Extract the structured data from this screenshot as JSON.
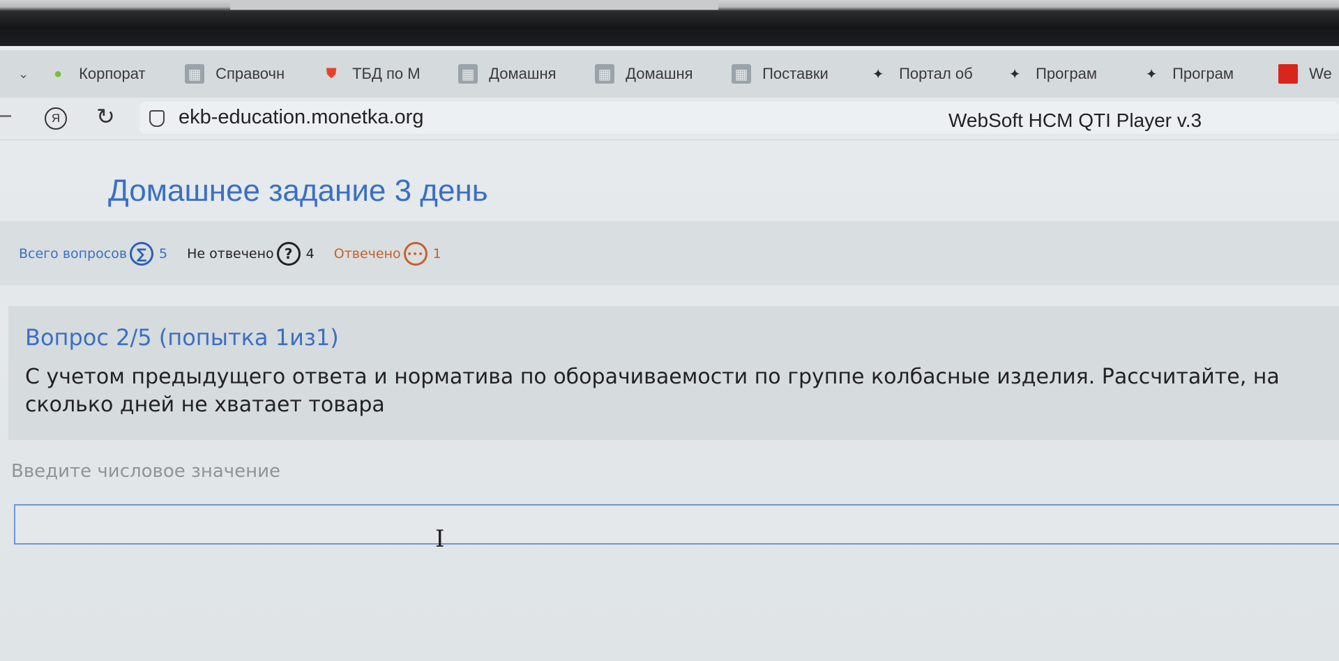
{
  "bookmarks": [
    {
      "label": "Корпорат",
      "icon": "map-pin-icon"
    },
    {
      "label": "Справочн",
      "icon": "chart-icon"
    },
    {
      "label": "ТБД по М",
      "icon": "shield-icon"
    },
    {
      "label": "Домашня",
      "icon": "chart-icon"
    },
    {
      "label": "Домашня",
      "icon": "chart-icon"
    },
    {
      "label": "Поставки",
      "icon": "chart-icon"
    },
    {
      "label": "Портал об",
      "icon": "star-icon"
    },
    {
      "label": "Програм",
      "icon": "star-icon"
    },
    {
      "label": "Програм",
      "icon": "star-icon"
    },
    {
      "label": "We",
      "icon": "red-square-icon"
    }
  ],
  "browser": {
    "yandex_glyph": "Я",
    "reload_glyph": "↻",
    "url": "ekb-education.monetka.org",
    "page_title": "WebSoft HCM QTI Player v.3"
  },
  "page": {
    "title": "Домашнее задание 3 день"
  },
  "stats": {
    "total_label": "Всего вопросов",
    "total_glyph": "∑",
    "total_count": "5",
    "unanswered_label": "Не отвечено",
    "unanswered_glyph": "?",
    "unanswered_count": "4",
    "answered_label": "Отвечено",
    "answered_glyph": "•••",
    "answered_count": "1"
  },
  "question": {
    "header": "Вопрос 2/5  (попытка 1из1)",
    "text": "С учетом предыдущего ответа и норматива по оборачиваемости по группе колбасные изделия. Рассчитайте, на сколько дней не хватает товара"
  },
  "answer": {
    "label": "Введите числовое значение",
    "value": ""
  },
  "colors": {
    "accent": "#3a6fc4",
    "answered": "#c8602a",
    "input_border": "#6d97d8"
  }
}
